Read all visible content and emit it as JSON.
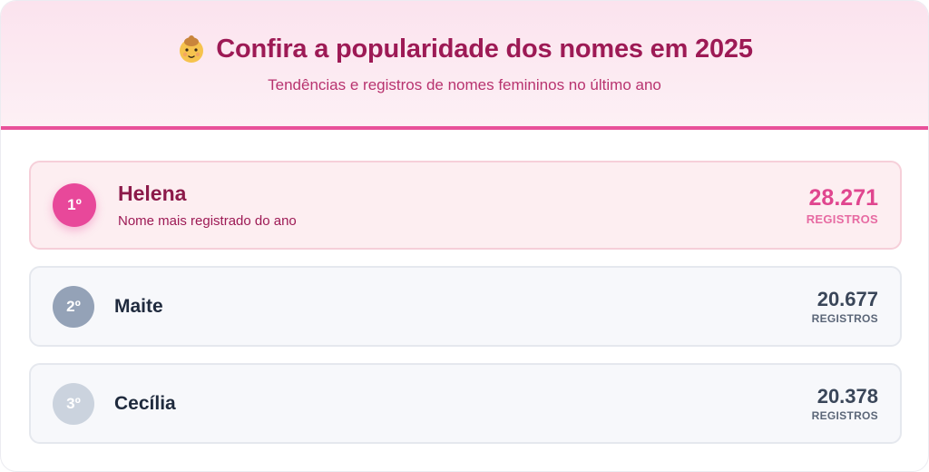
{
  "header": {
    "icon": "baby-face-icon",
    "title": "Confira a popularidade dos nomes em 2025",
    "subtitle": "Tendências e registros de nomes femininos no último ano"
  },
  "colors": {
    "accent": "#e8519a",
    "title": "#9d1a55",
    "gold": "#e8489a",
    "silver": "#94a2b7",
    "bronze": "#cbd3de"
  },
  "ranking": [
    {
      "position": "1º",
      "name": "Helena",
      "description": "Nome mais registrado do ano",
      "count": "28.271",
      "unit": "REGISTROS"
    },
    {
      "position": "2º",
      "name": "Maite",
      "count": "20.677",
      "unit": "REGISTROS"
    },
    {
      "position": "3º",
      "name": "Cecília",
      "count": "20.378",
      "unit": "REGISTROS"
    }
  ]
}
